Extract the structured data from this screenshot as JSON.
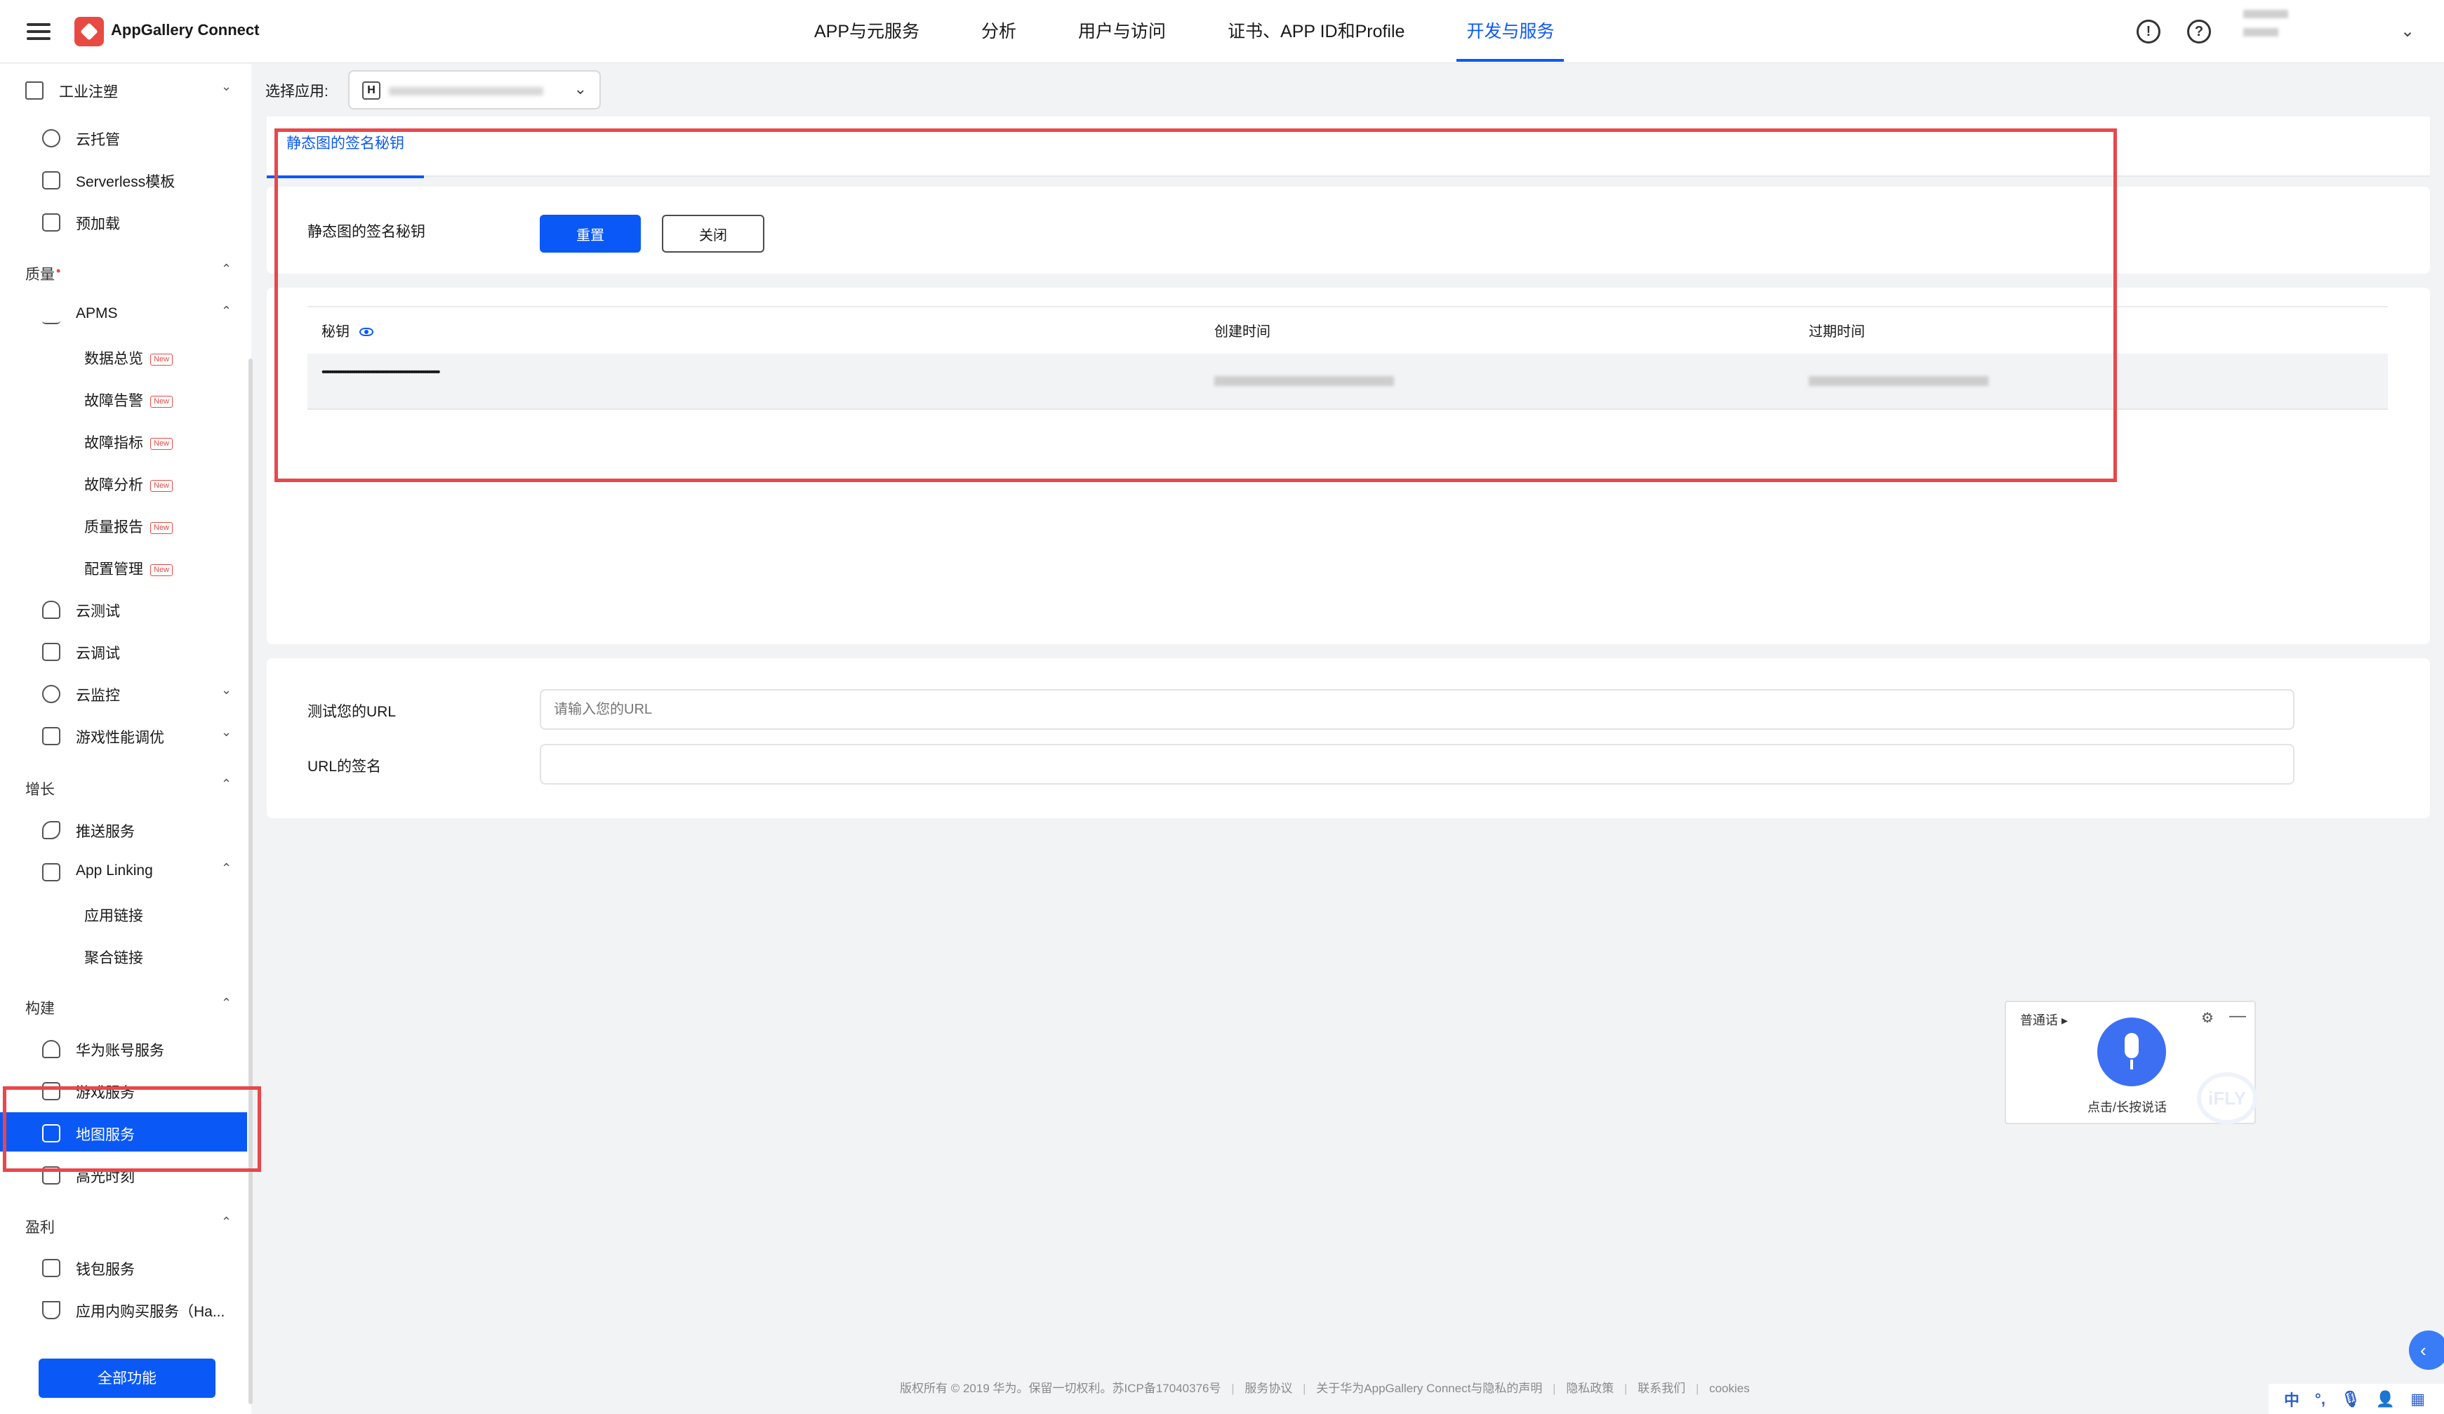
{
  "header": {
    "brand": "AppGallery Connect",
    "nav": [
      "APP与元服务",
      "分析",
      "用户与访问",
      "证书、APP ID和Profile",
      "开发与服务"
    ],
    "active_nav": "开发与服务"
  },
  "sidebar": {
    "project": "工业注塑",
    "items": {
      "cloud_hosting": "云托管",
      "serverless": "Serverless模板",
      "preload": "预加载",
      "quality": "质量",
      "apms": "APMS",
      "data_overview": "数据总览",
      "fault_alert": "故障告警",
      "fault_metrics": "故障指标",
      "fault_analysis": "故障分析",
      "quality_report": "质量报告",
      "config_mgmt": "配置管理",
      "cloud_test": "云测试",
      "cloud_debug": "云调试",
      "cloud_monitor": "云监控",
      "game_perf": "游戏性能调优",
      "growth": "增长",
      "push": "推送服务",
      "app_linking": "App Linking",
      "app_link": "应用链接",
      "aggregate_link": "聚合链接",
      "build": "构建",
      "huawei_account": "华为账号服务",
      "game_service": "游戏服务",
      "map_service": "地图服务",
      "highlight": "高光时刻",
      "monetize": "盈利",
      "wallet": "钱包服务",
      "iap": "应用内购买服务（Ha..."
    },
    "new_badge": "New",
    "all_button": "全部功能"
  },
  "app_select": {
    "label": "选择应用:",
    "icon_letter": "H"
  },
  "tab": {
    "label": "静态图的签名秘钥"
  },
  "secret_section": {
    "label": "静态图的签名秘钥",
    "reset_button": "重置",
    "close_button": "关闭"
  },
  "table": {
    "headers": [
      "秘钥",
      "创建时间",
      "过期时间"
    ],
    "row": {
      "secret": "••••••••••••••••••••••••••••••••••••••••••••••••••••••••••••••••"
    }
  },
  "test_section": {
    "url_label": "测试您的URL",
    "url_placeholder": "请输入您的URL",
    "sig_label": "URL的签名"
  },
  "voice_widget": {
    "lang": "普通话 ▸",
    "hint": "点击/长按说话",
    "watermark": "iFLY"
  },
  "footer": {
    "copyright": "版权所有 © 2019 华为。保留一切权利。苏ICP备17040376号",
    "links": [
      "服务协议",
      "关于华为AppGallery Connect与隐私的声明",
      "隐私政策",
      "联系我们",
      "cookies"
    ]
  },
  "tray": [
    "中",
    "°,",
    "🎙",
    "👤",
    "▦"
  ],
  "colors": {
    "primary": "#0a59f7",
    "annotation": "#e9474b",
    "brand": "#e84a43"
  }
}
